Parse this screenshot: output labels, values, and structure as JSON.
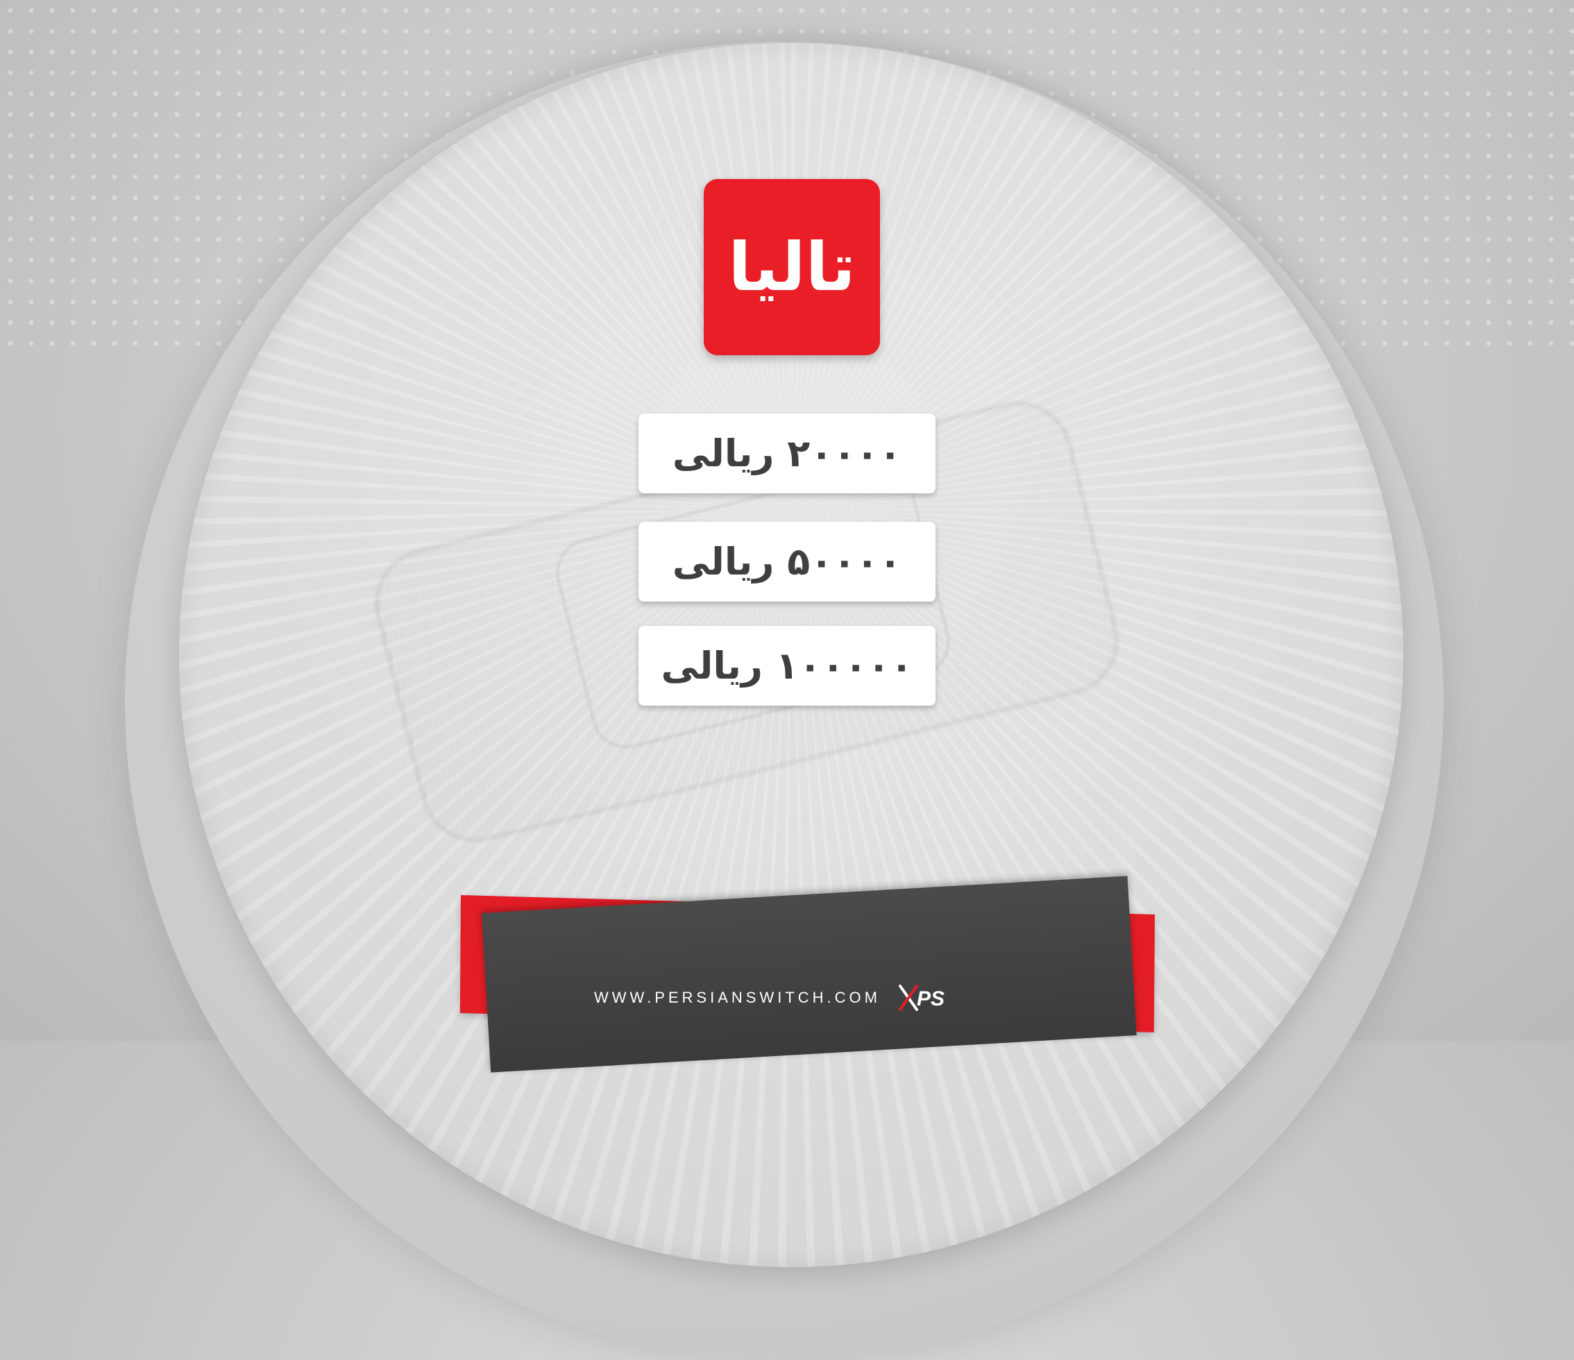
{
  "brand": {
    "logo_text": "تالیا",
    "logo_color": "#ea1e26"
  },
  "options": [
    {
      "label": "۲۰۰۰۰ ریالی"
    },
    {
      "label": "۵۰۰۰۰ ریالی"
    },
    {
      "label": "۱۰۰۰۰۰ ریالی"
    }
  ],
  "footer": {
    "url": "WWW.PERSIANSWITCH.COM",
    "logo_text": "PS",
    "accent_color": "#e31d26",
    "panel_color": "#3f3f3f"
  }
}
